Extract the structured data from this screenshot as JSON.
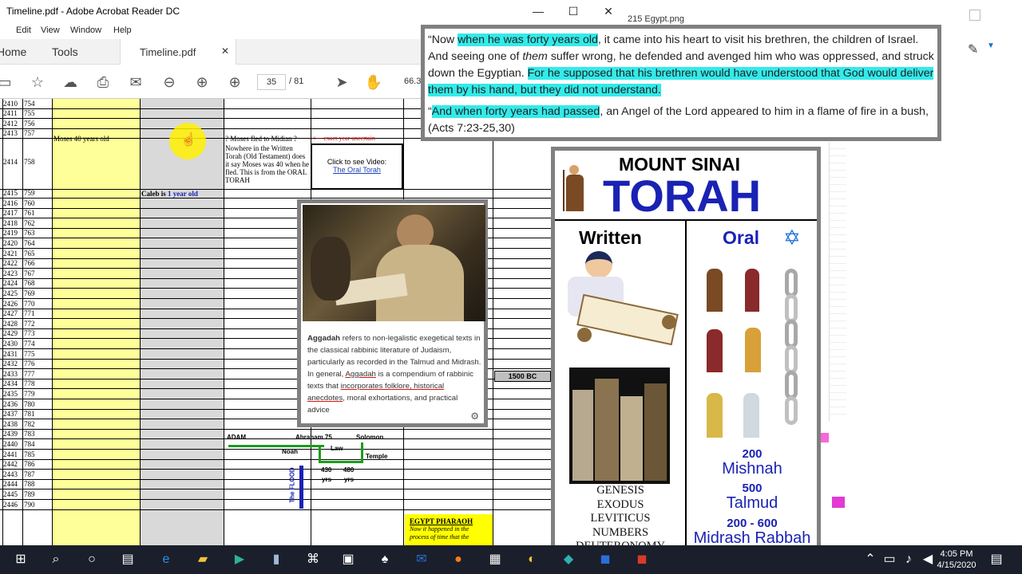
{
  "acrobat": {
    "window_title": "Timeline.pdf - Adobe Acrobat Reader DC",
    "menu": [
      "Edit",
      "View",
      "Window",
      "Help"
    ],
    "tabs": {
      "home": "Home",
      "tools": "Tools",
      "document": "Timeline.pdf"
    },
    "page_current": "35",
    "page_total": "/  81",
    "zoom": "66.3"
  },
  "background_window": {
    "title": "215 Egypt.png"
  },
  "sheet": {
    "rows": [
      [
        "2410",
        "754"
      ],
      [
        "2411",
        "755"
      ],
      [
        "2412",
        "756"
      ],
      [
        "2413",
        "757"
      ],
      [
        "2414",
        "758"
      ],
      [
        "2415",
        "759"
      ],
      [
        "2416",
        "760"
      ],
      [
        "2417",
        "761"
      ],
      [
        "2418",
        "762"
      ],
      [
        "2419",
        "763"
      ],
      [
        "2420",
        "764"
      ],
      [
        "2421",
        "765"
      ],
      [
        "2422",
        "766"
      ],
      [
        "2423",
        "767"
      ],
      [
        "2424",
        "768"
      ],
      [
        "2425",
        "769"
      ],
      [
        "2426",
        "770"
      ],
      [
        "2427",
        "771"
      ],
      [
        "2428",
        "772"
      ],
      [
        "2429",
        "773"
      ],
      [
        "2430",
        "774"
      ],
      [
        "2431",
        "775"
      ],
      [
        "2432",
        "776"
      ],
      [
        "2433",
        "777"
      ],
      [
        "2434",
        "778"
      ],
      [
        "2435",
        "779"
      ],
      [
        "2436",
        "780"
      ],
      [
        "2437",
        "781"
      ],
      [
        "2438",
        "782"
      ],
      [
        "2439",
        "783"
      ],
      [
        "2440",
        "784"
      ],
      [
        "2441",
        "785"
      ],
      [
        "2442",
        "786"
      ],
      [
        "2443",
        "787"
      ],
      [
        "2444",
        "788"
      ],
      [
        "2445",
        "789"
      ],
      [
        "2446",
        "790"
      ]
    ],
    "moses_cell": "Moses 40 years old",
    "midian_cell": "? Moses fled to Midian ?",
    "exact_year": "<--- exact year uncertain",
    "nowhere_cell": "Nowhere in the Written Torah (Old Testament) does it say Moses was 40 when he fled.  This is from the ORAL TORAH",
    "video_label": "Click to see Video:",
    "video_link": "The Oral Torah",
    "caleb_prefix": "Caleb is ",
    "caleb_highlight": "1 year old",
    "bc_label": "1500 BC",
    "egypt_title": "EGYPT PHARAOH",
    "egypt_sub": "Now it happened in the process of time that the"
  },
  "timeline": {
    "adam": "ADAM",
    "abraham": "Abraham 75",
    "solomon": "Solomon",
    "noah": "Noah",
    "law": "Law",
    "temple": "Temple",
    "yrs430": "430",
    "yrs480": "480",
    "yrs": "yrs",
    "flood": "The FLOOD"
  },
  "popup": {
    "term": "Aggadah",
    "text1": " refers to non-legalistic exegetical texts in the classical rabbinic literature of Judaism, particularly as recorded in the Talmud and Midrash. In general, ",
    "term2": "Aggadah",
    "text2": " is a compendium of rabbinic texts that ",
    "underlined": "incorporates folklore, historical anecdotes",
    "text3": ", moral exhortations, and practical advice"
  },
  "quote": {
    "p1_a": "“Now ",
    "p1_hl1": "when he was forty years old",
    "p1_b": ", it came into his heart to visit his brethren, the children of Israel. And seeing one of ",
    "p1_em": "them",
    "p1_c": " suffer wrong, he defended and avenged him who was oppressed, and struck down the Egyptian. ",
    "p1_hl2": "For he supposed that his brethren would have understood that God would deliver them by his hand, but they did not understand.",
    "p2_a": "“",
    "p2_hl": "And when forty years had passed",
    "p2_b": ", an Angel of the Lord appeared to him in a flame of fire in a bush, (Acts 7:23-25,30)"
  },
  "torah": {
    "title1": "MOUNT SINAI",
    "title2": "TORAH",
    "written": "Written",
    "oral": "Oral",
    "books": [
      "GENESIS",
      "EXODUS",
      "LEVITICUS",
      "NUMBERS",
      "DEUTERONOMY"
    ],
    "mishnah_year": "200",
    "mishnah": "Mishnah",
    "talmud_year": "500",
    "talmud": "Talmud",
    "midrash_year": "200 - 600",
    "midrash": "Midrash Rabbah"
  },
  "taskbar": {
    "time": "4:05 PM",
    "date": "4/15/2020"
  },
  "colors": {
    "highlight": "#33eaea",
    "torah_blue": "#1a22b4",
    "taskbar": "#1a1f2b"
  }
}
